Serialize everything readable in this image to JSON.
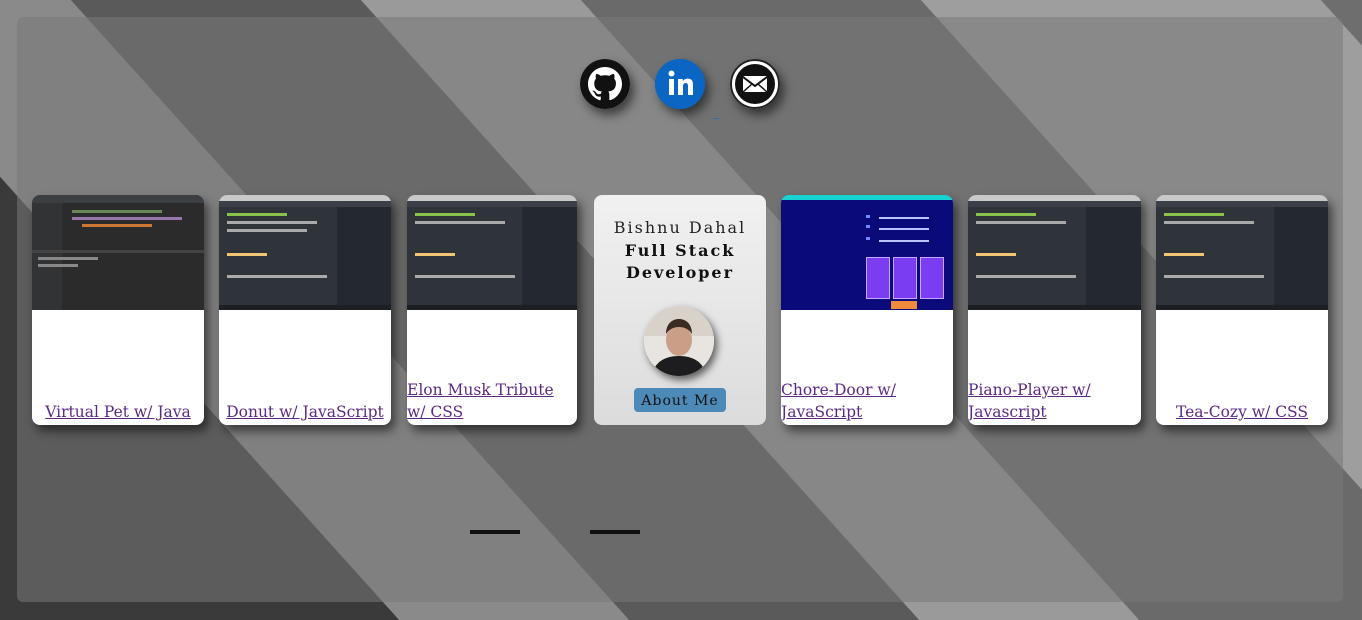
{
  "social": {
    "github_label": "GitHub",
    "linkedin_label": "LinkedIn",
    "email_label": "Email"
  },
  "profile": {
    "name": "Bishnu Dahal",
    "role_line1": "Full Stack",
    "role_line2": "Developer",
    "about_button": "About Me"
  },
  "projects": [
    {
      "title": "Virtual Pet w/ Java"
    },
    {
      "title": "Donut w/ JavaScript"
    },
    {
      "title": "Elon Musk Tribute w/ CSS"
    },
    {
      "title": "Chore-Door w/ JavaScript"
    },
    {
      "title": "Piano-Player w/ Javascript"
    },
    {
      "title": "Tea-Cozy w/ CSS"
    }
  ],
  "colors": {
    "link": "#5b2a86",
    "about_button": "#4d8ab7",
    "linkedin": "#0a66c2"
  },
  "carousel": {
    "slides": 2
  }
}
